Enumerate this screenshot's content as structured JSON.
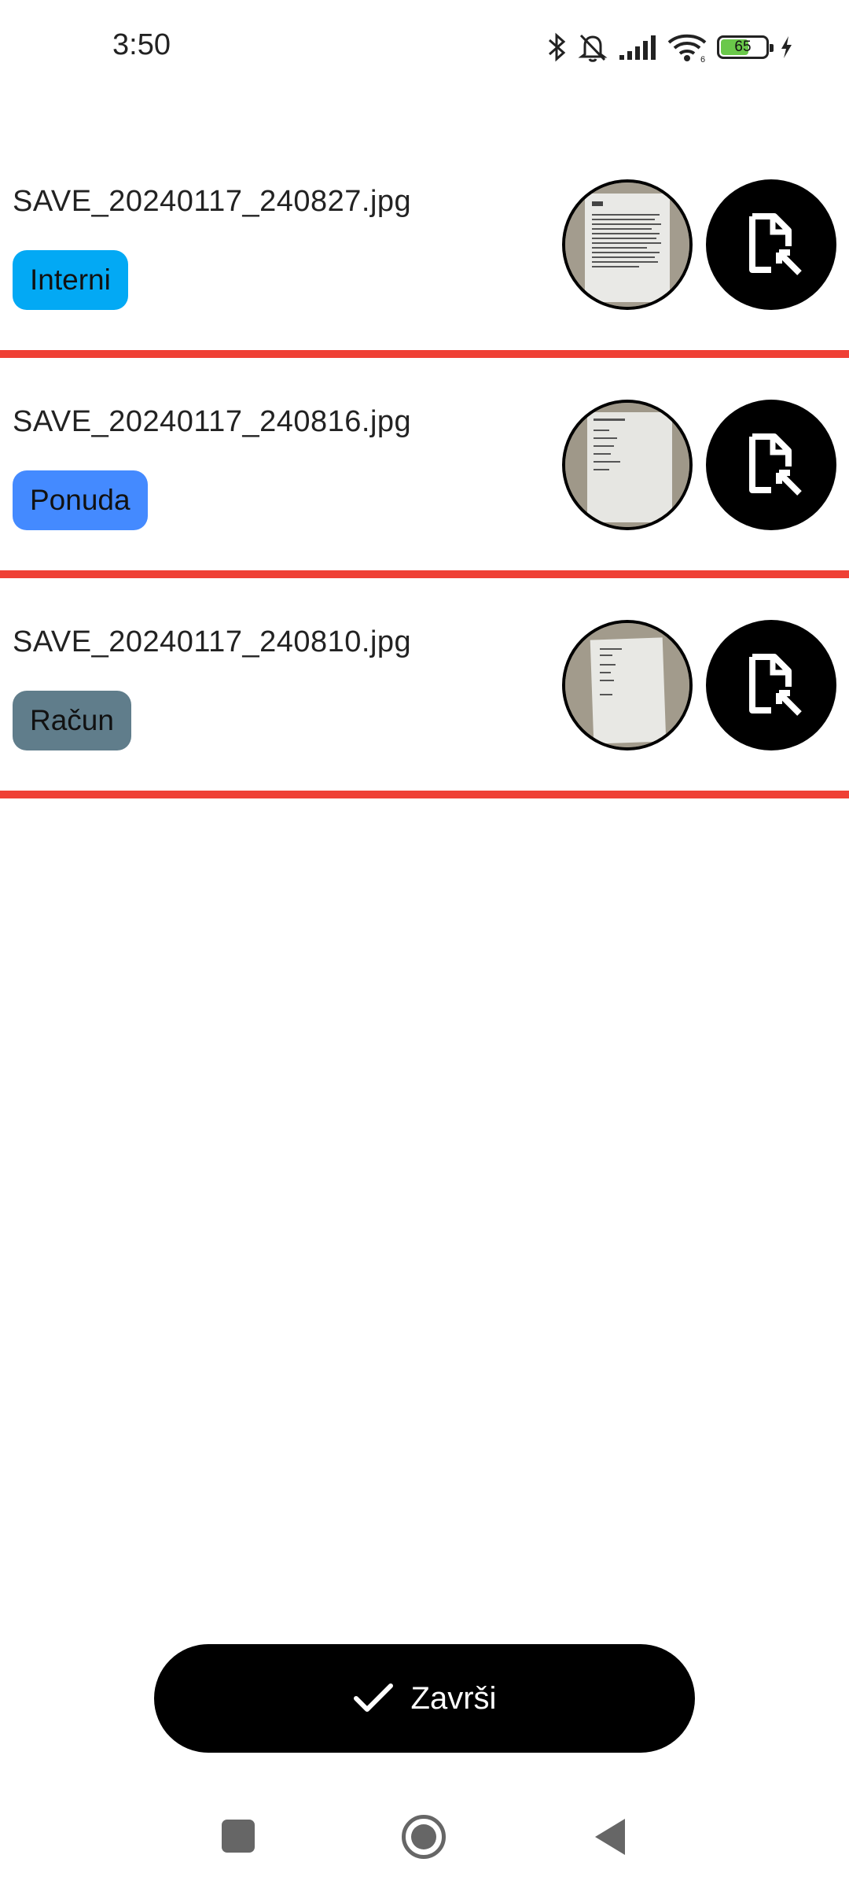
{
  "status_bar": {
    "time": "3:50",
    "battery_level": "65",
    "battery_fill_fraction": 0.65,
    "icons": [
      "bluetooth-icon",
      "bell-off-icon",
      "signal-icon",
      "wifi-icon",
      "battery-icon",
      "charging-icon"
    ]
  },
  "documents": [
    {
      "filename": "SAVE_20240117_240827.jpg",
      "tag": "Interni",
      "tag_color": "#03a9f4",
      "thumbnail_icon": "document-photo-thumbnail",
      "action_icon": "file-open-icon"
    },
    {
      "filename": "SAVE_20240117_240816.jpg",
      "tag": "Ponuda",
      "tag_color": "#448aff",
      "thumbnail_icon": "document-photo-thumbnail",
      "action_icon": "file-open-icon"
    },
    {
      "filename": "SAVE_20240117_240810.jpg",
      "tag": "Račun",
      "tag_color": "#607d8b",
      "thumbnail_icon": "document-photo-thumbnail",
      "action_icon": "file-open-icon"
    }
  ],
  "finish_button": {
    "label": "Završi",
    "icon": "check-icon"
  },
  "nav_bar": {
    "icons": [
      "recents-icon",
      "home-icon",
      "back-icon"
    ]
  },
  "colors": {
    "divider": "#ef4035",
    "button_background": "#000000"
  }
}
